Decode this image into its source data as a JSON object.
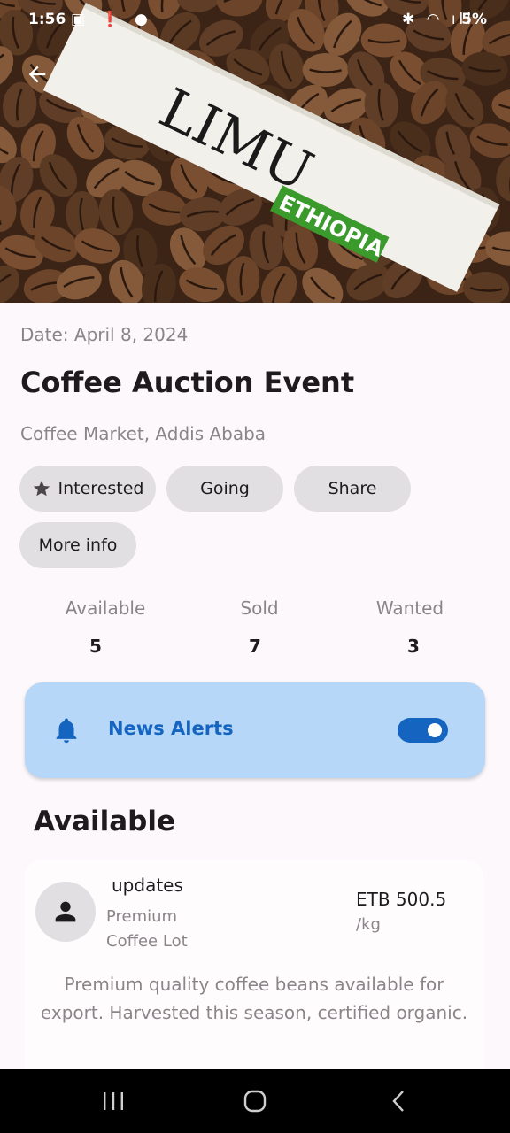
{
  "status_bar": {
    "time": "1:56",
    "battery": "5%"
  },
  "hero": {
    "tag_brand": "LIMU",
    "tag_region": "ETHIOPIA"
  },
  "event": {
    "date": "Date: April 8, 2024",
    "title": "Coffee Auction Event",
    "location": "Coffee Market, Addis Ababa"
  },
  "actions": {
    "interested": "Interested",
    "going": "Going",
    "share": "Share",
    "more_info": "More info"
  },
  "stats": [
    {
      "label": "Available",
      "value": "5"
    },
    {
      "label": "Sold",
      "value": "7"
    },
    {
      "label": "Wanted",
      "value": "3"
    }
  ],
  "alerts": {
    "label": "News Alerts",
    "enabled": true
  },
  "section": {
    "title": "Available"
  },
  "listing": {
    "seller": "updates",
    "lot_name": "Premium Coffee Lot",
    "price": "ETB 500.5",
    "unit": "/kg",
    "description": "Premium quality coffee beans available for export. Harvested this season, certified organic."
  },
  "colors": {
    "accent": "#1565c0",
    "alerts_bg": "#b6d7f7",
    "chip_bg": "#e2dfe2",
    "tag_green": "#3b9a2c"
  },
  "icons": {
    "back": "arrow-back-icon",
    "star": "star-icon",
    "bell": "bell-icon",
    "avatar": "person-icon"
  }
}
